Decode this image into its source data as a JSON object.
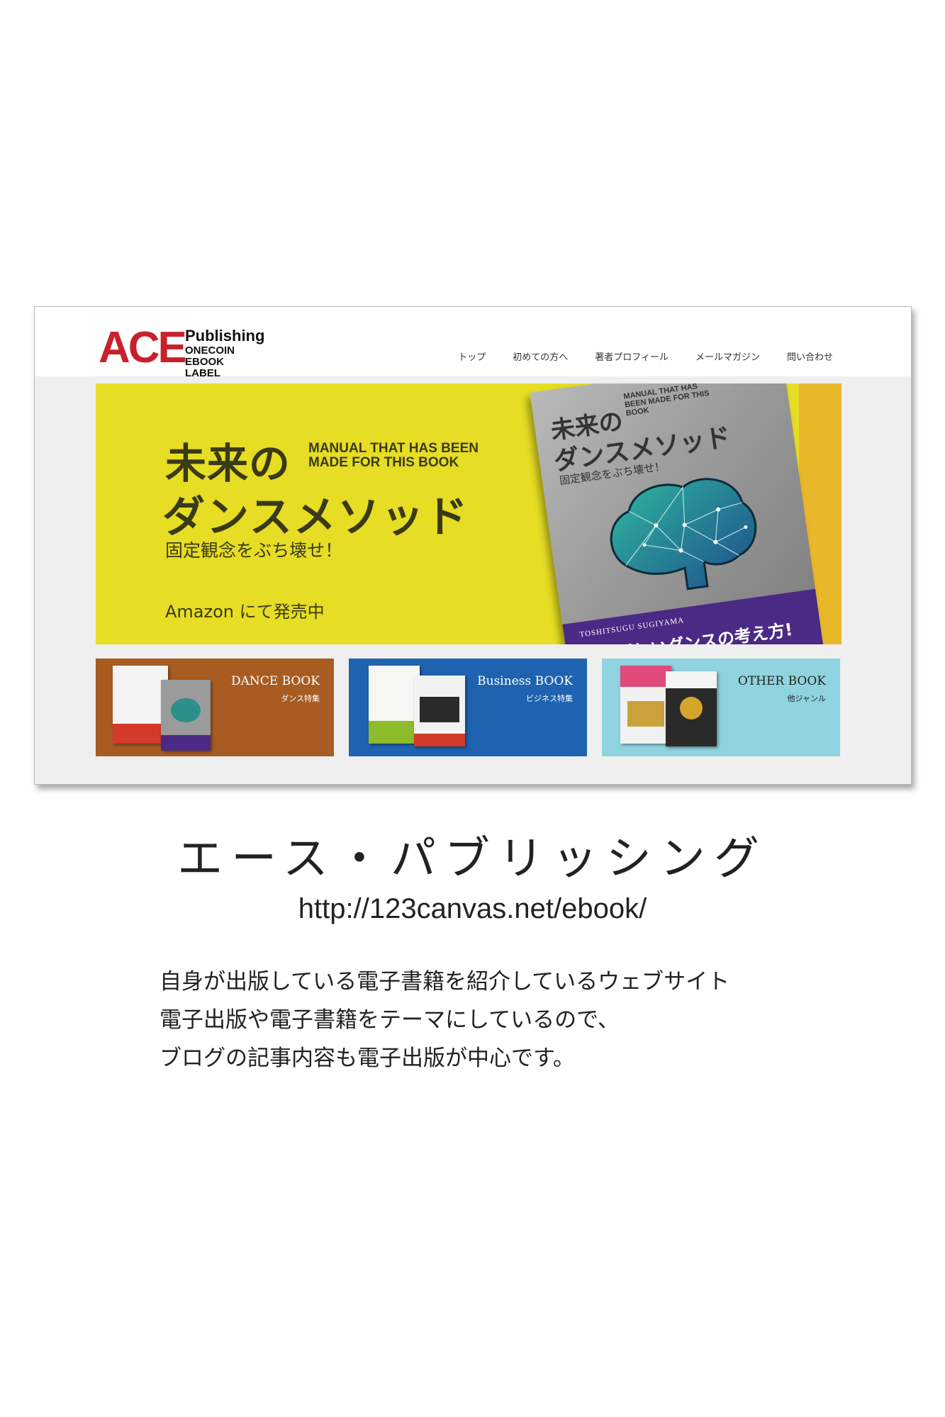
{
  "logo": {
    "ace": "ACE",
    "publishing": "Publishing",
    "line1": "ONECOIN",
    "line2": "EBOOK LABEL"
  },
  "nav": [
    "トップ",
    "初めての方へ",
    "著者プロフィール",
    "メールマガジン",
    "問い合わせ"
  ],
  "hero": {
    "title_line1": "未来の",
    "title_line2": "ダンスメソッド",
    "english": "MANUAL THAT HAS BEEN MADE FOR THIS BOOK",
    "subtitle": "固定観念をぶち壊せ！",
    "amazon": "Amazon にて発売中",
    "cover": {
      "title_line1": "未来の",
      "title_line2": "ダンスメソッド",
      "english": "MANUAL THAT HAS BEEN MADE FOR THIS BOOK",
      "subtitle": "固定観念をぶち壊せ！",
      "author": "TOSHITSUGU SUGIYAMA",
      "catch": "全く新しいダンスの考え方!"
    }
  },
  "cards": [
    {
      "title": "DANCE BOOK",
      "sub": "ダンス特集"
    },
    {
      "title": "Business BOOK",
      "sub": "ビジネス特集"
    },
    {
      "title": "OTHER BOOK",
      "sub": "他ジャンル"
    }
  ],
  "caption": {
    "site_name": "エース・パブリッシング",
    "url": "http://123canvas.net/ebook/",
    "description": [
      "自身が出版している電子書籍を紹介しているウェブサイト",
      "電子出版や電子書籍をテーマにしているので、",
      "ブログの記事内容も電子出版が中心です。"
    ]
  },
  "colors": {
    "brand_red": "#c8202d",
    "hero_yellow": "#e6dd24",
    "cover_purple": "#4a2a84",
    "dance_card": "#a85c22",
    "business_card": "#1f63b0",
    "other_card": "#8fd3de"
  }
}
